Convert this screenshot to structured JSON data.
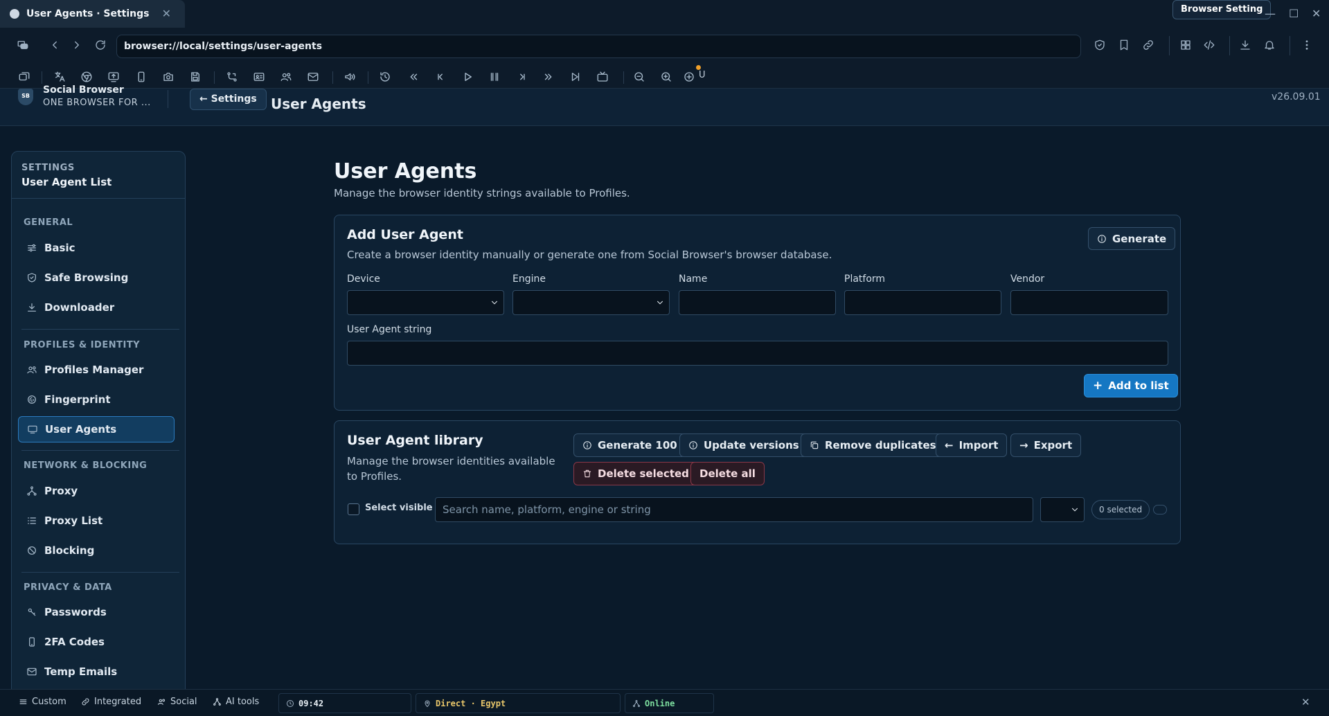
{
  "window": {
    "tab_title": "User Agents · Settings",
    "badge": "Browser Setting",
    "address": "browser://local/settings/user-agents"
  },
  "app": {
    "brand_name": "Social Browser",
    "brand_tagline": "ONE BROWSER FOR ...",
    "logo_text": "SB",
    "back_label": "← Settings",
    "header_title": "User Agents",
    "version": "v26.09.01"
  },
  "sidebar": {
    "kicker": "SETTINGS",
    "title": "User Agent List",
    "groups": [
      {
        "label": "GENERAL",
        "items": [
          {
            "label": "Basic",
            "icon": "sliders-icon"
          },
          {
            "label": "Safe Browsing",
            "icon": "shield-icon"
          },
          {
            "label": "Downloader",
            "icon": "download-icon"
          }
        ]
      },
      {
        "label": "PROFILES & IDENTITY",
        "items": [
          {
            "label": "Profiles Manager",
            "icon": "users-icon"
          },
          {
            "label": "Fingerprint",
            "icon": "fingerprint-icon"
          },
          {
            "label": "User Agents",
            "icon": "monitor-icon",
            "active": true
          }
        ]
      },
      {
        "label": "NETWORK & BLOCKING",
        "items": [
          {
            "label": "Proxy",
            "icon": "network-icon"
          },
          {
            "label": "Proxy List",
            "icon": "list-icon"
          },
          {
            "label": "Blocking",
            "icon": "block-icon"
          }
        ]
      },
      {
        "label": "PRIVACY & DATA",
        "items": [
          {
            "label": "Passwords",
            "icon": "key-icon"
          },
          {
            "label": "2FA Codes",
            "icon": "phone-icon"
          },
          {
            "label": "Temp Emails",
            "icon": "mail-icon"
          }
        ]
      }
    ]
  },
  "main": {
    "title": "User Agents",
    "subtitle": "Manage the browser identity strings available to Profiles."
  },
  "add_card": {
    "title": "Add User Agent",
    "subtitle": "Create a browser identity manually or generate one from Social Browser's browser database.",
    "generate_label": "Generate",
    "fields": {
      "device_label": "Device",
      "engine_label": "Engine",
      "name_label": "Name",
      "platform_label": "Platform",
      "vendor_label": "Vendor",
      "ua_label": "User Agent string"
    },
    "add_label": "Add to list"
  },
  "library_card": {
    "title": "User Agent library",
    "subtitle": "Manage the browser identities available to Profiles.",
    "buttons": {
      "generate100": "Generate 100",
      "update_versions": "Update versions",
      "remove_duplicates": "Remove duplicates",
      "import": "Import",
      "export": "Export",
      "delete_selected": "Delete selected",
      "delete_all": "Delete all"
    },
    "select_visible": "Select visible",
    "search_placeholder": "Search name, platform, engine or string",
    "selected_count": "0 selected"
  },
  "statusbar": {
    "custom": "Custom",
    "integrated": "Integrated",
    "social": "Social",
    "ai_tools": "AI tools",
    "clock": "09:42",
    "proxy": "Direct · Egypt",
    "network": "Online"
  },
  "colors": {
    "accent": "#1577c3",
    "clock": "#e6edf3",
    "proxy": "#e8c66a",
    "online": "#7ee0a0",
    "danger": "#8a3848"
  }
}
